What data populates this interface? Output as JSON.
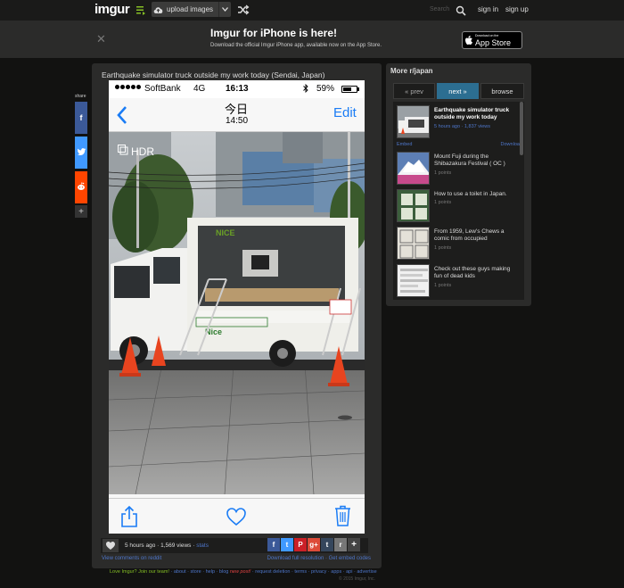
{
  "nav": {
    "logo": "imgur",
    "upload_label": "upload images",
    "search_placeholder": "Search",
    "signin": "sign in",
    "signup": "sign up"
  },
  "banner": {
    "title": "Imgur for iPhone is here!",
    "subtitle": "Download the official Imgur iPhone app, available now on the App Store.",
    "appstore_small": "Download on the",
    "appstore_big": "App Store"
  },
  "share": {
    "label": "share"
  },
  "post": {
    "title": "Earthquake simulator truck outside my work today (Sendai, Japan)",
    "stats_prefix": "5 hours ago · 1,569 views · ",
    "stats_link": "stats",
    "view_comments": "View comments on reddit",
    "download": "Download full resolution",
    "embed": "Get embed codes"
  },
  "phone": {
    "carrier": "SoftBank",
    "network": "4G",
    "time": "16:13",
    "battery": "59%",
    "nav_date": "今日",
    "nav_time": "14:50",
    "edit": "Edit",
    "hdr": "HDR"
  },
  "sidebar": {
    "title": "More r/japan",
    "prev": "« prev",
    "next": "next »",
    "browse": "browse",
    "embed": "Embed",
    "download": "Download",
    "items": [
      {
        "title": "Earthquake simulator truck outside my work today",
        "meta": "5 hours ago · 1,837 views"
      },
      {
        "title": "Mount Fuji during the Shibazakura Festival ( OC )",
        "meta": "1 points"
      },
      {
        "title": "How to use a toilet in Japan.",
        "meta": "1 points"
      },
      {
        "title": "From 1959, Lew's Chews a comic from occupied",
        "meta": "1 points"
      },
      {
        "title": "Check out these guys making fun of dead kids",
        "meta": "1 points"
      }
    ]
  },
  "footer": {
    "green": "Love Imgur? Join our team!",
    "links": [
      "about",
      "store",
      "help",
      "blog"
    ],
    "new_post": "new post!",
    "links2": [
      "request deletion",
      "terms",
      "privacy",
      "apps",
      "api",
      "advertise"
    ],
    "copyright": "© 2015 Imgur, Inc."
  },
  "colors": {
    "accent_green": "#85bf25",
    "link_blue": "#4e76c9",
    "ios_blue": "#1a7cf5"
  }
}
